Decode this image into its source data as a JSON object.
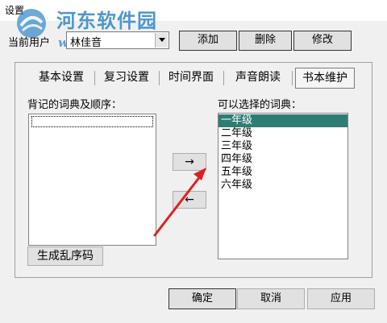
{
  "window": {
    "title": "设置"
  },
  "watermark": {
    "name": "河东软件园",
    "url": "www.pc0359.cn"
  },
  "user": {
    "label": "当前用户",
    "selected": "林佳音",
    "add_label": "添加",
    "delete_label": "删除",
    "edit_label": "修改"
  },
  "tabs": [
    {
      "label": "基本设置"
    },
    {
      "label": "复习设置"
    },
    {
      "label": "时间界面"
    },
    {
      "label": "声音朗读"
    },
    {
      "label": "书本维护"
    }
  ],
  "left": {
    "label": "背记的词典及顺序：",
    "random_button": "生成乱序码"
  },
  "right": {
    "label": "可以选择的词典：",
    "items": [
      "一年级",
      "二年级",
      "三年级",
      "四年级",
      "五年级",
      "六年级"
    ]
  },
  "move": {
    "add_arrow": "→",
    "remove_arrow": "←"
  },
  "footer": {
    "ok_label": "确定",
    "cancel_label": "取消",
    "apply_label": "应用"
  },
  "colors": {
    "selection": "#2e7d74",
    "annotation_arrow": "#e02020",
    "watermark": "#2f86c9"
  }
}
